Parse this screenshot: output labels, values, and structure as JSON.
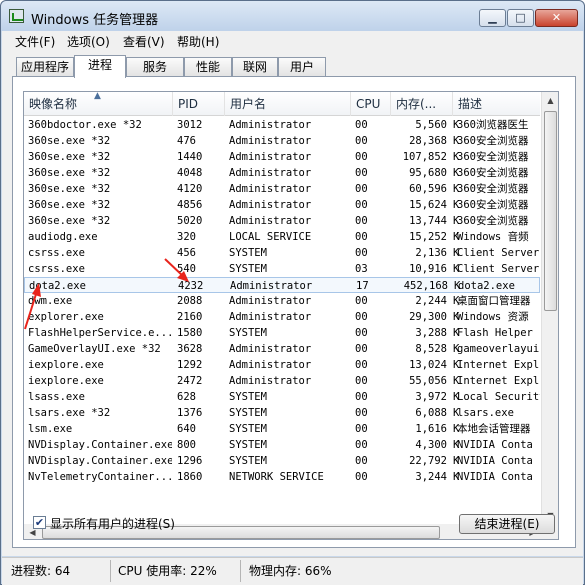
{
  "window": {
    "title": "Windows 任务管理器"
  },
  "menu": [
    "文件(F)",
    "选项(O)",
    "查看(V)",
    "帮助(H)"
  ],
  "tabs": [
    "应用程序",
    "进程",
    "服务",
    "性能",
    "联网",
    "用户"
  ],
  "active_tab": "进程",
  "columns": {
    "name": "映像名称",
    "pid": "PID",
    "user": "用户名",
    "cpu": "CPU",
    "mem": "内存(...",
    "desc": "描述"
  },
  "rows": [
    {
      "name": "360bdoctor.exe *32",
      "pid": "3012",
      "user": "Administrator",
      "cpu": "00",
      "mem": "5,560",
      "unit": "K",
      "desc": "360浏览器医生"
    },
    {
      "name": "360se.exe *32",
      "pid": "476",
      "user": "Administrator",
      "cpu": "00",
      "mem": "28,368",
      "unit": "K",
      "desc": "360安全浏览器"
    },
    {
      "name": "360se.exe *32",
      "pid": "1440",
      "user": "Administrator",
      "cpu": "00",
      "mem": "107,852",
      "unit": "K",
      "desc": "360安全浏览器"
    },
    {
      "name": "360se.exe *32",
      "pid": "4048",
      "user": "Administrator",
      "cpu": "00",
      "mem": "95,680",
      "unit": "K",
      "desc": "360安全浏览器"
    },
    {
      "name": "360se.exe *32",
      "pid": "4120",
      "user": "Administrator",
      "cpu": "00",
      "mem": "60,596",
      "unit": "K",
      "desc": "360安全浏览器"
    },
    {
      "name": "360se.exe *32",
      "pid": "4856",
      "user": "Administrator",
      "cpu": "00",
      "mem": "15,624",
      "unit": "K",
      "desc": "360安全浏览器"
    },
    {
      "name": "360se.exe *32",
      "pid": "5020",
      "user": "Administrator",
      "cpu": "00",
      "mem": "13,744",
      "unit": "K",
      "desc": "360安全浏览器"
    },
    {
      "name": "audiodg.exe",
      "pid": "320",
      "user": "LOCAL SERVICE",
      "cpu": "00",
      "mem": "15,252",
      "unit": "K",
      "desc": "Windows 音频"
    },
    {
      "name": "csrss.exe",
      "pid": "456",
      "user": "SYSTEM",
      "cpu": "00",
      "mem": "2,136",
      "unit": "K",
      "desc": "Client Server"
    },
    {
      "name": "csrss.exe",
      "pid": "540",
      "user": "SYSTEM",
      "cpu": "03",
      "mem": "10,916",
      "unit": "K",
      "desc": "Client Server"
    },
    {
      "name": "dota2.exe",
      "pid": "4232",
      "user": "Administrator",
      "cpu": "17",
      "mem": "452,168",
      "unit": "K",
      "desc": "dota2.exe",
      "selected": true
    },
    {
      "name": "dwm.exe",
      "pid": "2088",
      "user": "Administrator",
      "cpu": "00",
      "mem": "2,244",
      "unit": "K",
      "desc": "桌面窗口管理器"
    },
    {
      "name": "explorer.exe",
      "pid": "2160",
      "user": "Administrator",
      "cpu": "00",
      "mem": "29,300",
      "unit": "K",
      "desc": "Windows 资源"
    },
    {
      "name": "FlashHelperService.e...",
      "pid": "1580",
      "user": "SYSTEM",
      "cpu": "00",
      "mem": "3,288",
      "unit": "K",
      "desc": "Flash Helper"
    },
    {
      "name": "GameOverlayUI.exe *32",
      "pid": "3628",
      "user": "Administrator",
      "cpu": "00",
      "mem": "8,528",
      "unit": "K",
      "desc": "gameoverlayui"
    },
    {
      "name": "iexplore.exe",
      "pid": "1292",
      "user": "Administrator",
      "cpu": "00",
      "mem": "13,024",
      "unit": "K",
      "desc": "Internet Expl"
    },
    {
      "name": "iexplore.exe",
      "pid": "2472",
      "user": "Administrator",
      "cpu": "00",
      "mem": "55,056",
      "unit": "K",
      "desc": "Internet Expl"
    },
    {
      "name": "lsass.exe",
      "pid": "628",
      "user": "SYSTEM",
      "cpu": "00",
      "mem": "3,972",
      "unit": "K",
      "desc": "Local Security"
    },
    {
      "name": "lsars.exe *32",
      "pid": "1376",
      "user": "SYSTEM",
      "cpu": "00",
      "mem": "6,088",
      "unit": "K",
      "desc": "lsars.exe"
    },
    {
      "name": "lsm.exe",
      "pid": "640",
      "user": "SYSTEM",
      "cpu": "00",
      "mem": "1,616",
      "unit": "K",
      "desc": "本地会话管理器"
    },
    {
      "name": "NVDisplay.Container.exe",
      "pid": "800",
      "user": "SYSTEM",
      "cpu": "00",
      "mem": "4,300",
      "unit": "K",
      "desc": "NVIDIA Conta"
    },
    {
      "name": "NVDisplay.Container.exe",
      "pid": "1296",
      "user": "SYSTEM",
      "cpu": "00",
      "mem": "22,792",
      "unit": "K",
      "desc": "NVIDIA Conta"
    },
    {
      "name": "NvTelemetryContainer...",
      "pid": "1860",
      "user": "NETWORK SERVICE",
      "cpu": "00",
      "mem": "3,244",
      "unit": "K",
      "desc": "NVIDIA Conta"
    }
  ],
  "show_all_users": {
    "label": "显示所有用户的进程(S)",
    "checked": true
  },
  "end_process": "结束进程(E)",
  "status": {
    "processes": "进程数: 64",
    "cpu": "CPU 使用率: 22%",
    "memory": "物理内存: 66%"
  },
  "annotation_color": "#e8241c"
}
